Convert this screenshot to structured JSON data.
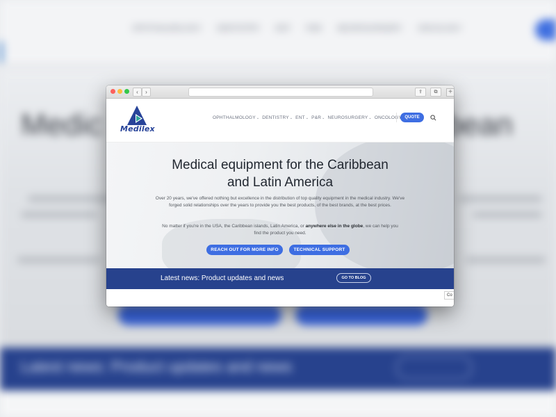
{
  "background": {
    "nav_items": [
      "OPHTHALMOLOGY",
      "DENTISTRY",
      "ENT",
      "P&R",
      "NEUROSURGERY",
      "ONCOLOGY"
    ],
    "title_left": "Medic",
    "title_right": "bean",
    "band_text": "Latest news: Product updates and news"
  },
  "browser": {
    "buttons": {
      "back": "‹",
      "forward": "›",
      "share": "⇪",
      "tabs": "⧉",
      "new_tab": "+"
    },
    "address": ""
  },
  "site": {
    "logo_text": "Medilex",
    "menu": [
      {
        "label": "OPHTHALMOLOGY",
        "dropdown": true
      },
      {
        "label": "DENTISTRY",
        "dropdown": true
      },
      {
        "label": "ENT",
        "dropdown": true
      },
      {
        "label": "P&R",
        "dropdown": true
      },
      {
        "label": "NEUROSURGERY",
        "dropdown": true
      },
      {
        "label": "ONCOLOGY",
        "dropdown": false
      }
    ],
    "quote_label": "QUOTE",
    "icons": {
      "search": "search-icon",
      "dropdown": "chevron-down-icon"
    },
    "colors": {
      "accent": "#3e6ee2",
      "brand": "#274399",
      "band": "#27428d"
    }
  },
  "hero": {
    "title_line1": "Medical equipment for the Caribbean",
    "title_line2": "and Latin America",
    "paragraph1": "Over 20 years, we've offered nothing but excellence in the distribution of top quality equipment in the medical industry. We've forged solid relationships over the years to provide you the best products, of the best brands, at the best prices.",
    "paragraph2_before": "No matter if you're in the USA, the Caribbean islands, Latin America, or ",
    "paragraph2_bold": "anywhere else in the globe",
    "paragraph2_after": ", we can help you find the product you need.",
    "button_contact": "REACH OUT FOR MORE INFO",
    "button_support": "TECHNICAL SUPPORT"
  },
  "news": {
    "text": "Latest news: Product updates and news",
    "button": "GO TO BLOG"
  },
  "cookie_tab": "Co"
}
